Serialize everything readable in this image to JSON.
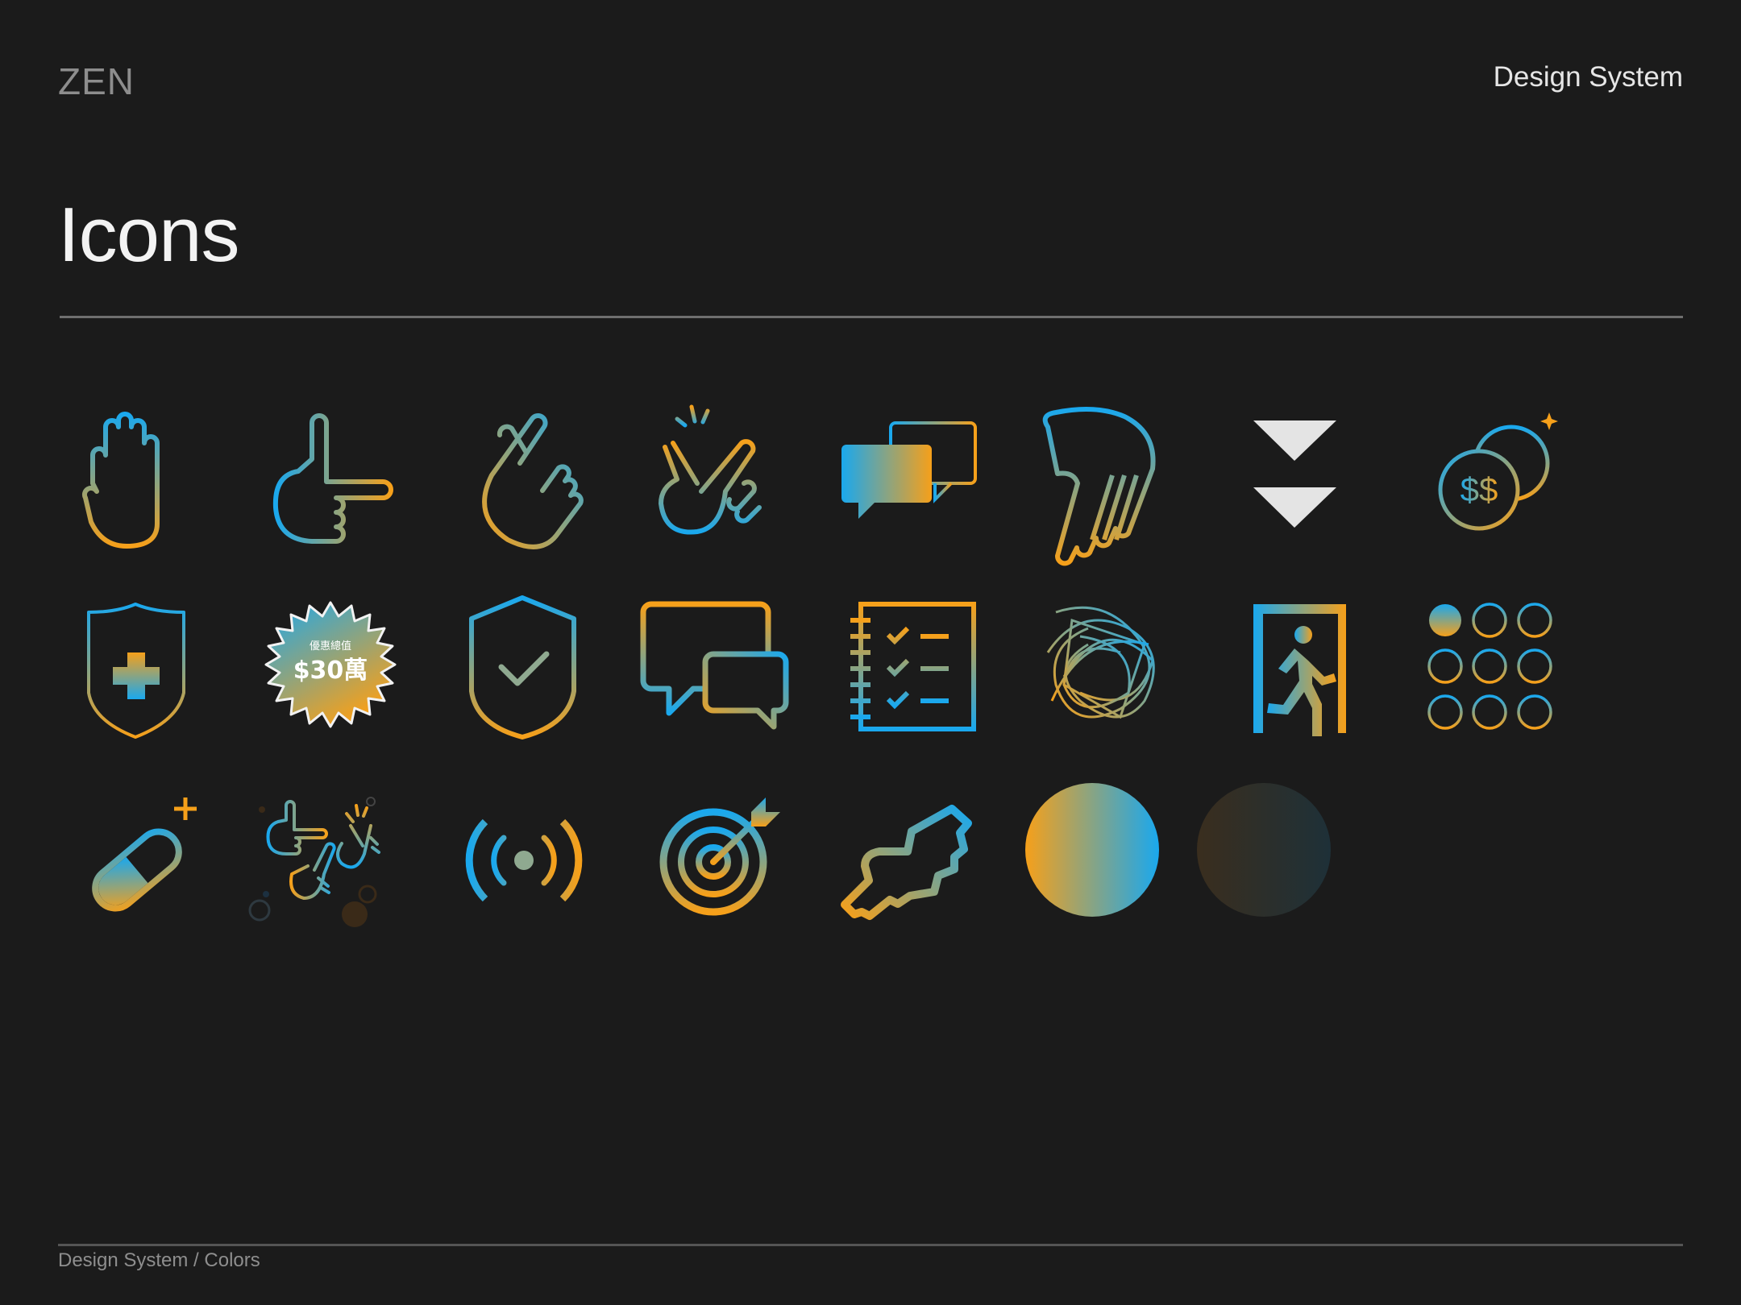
{
  "header": {
    "brand": "ZEN",
    "section": "Design System"
  },
  "page": {
    "title": "Icons"
  },
  "footer": {
    "breadcrumb": "Design System / Colors"
  },
  "colors": {
    "background": "#1b1b1b",
    "accent_blue": "#1aa8ee",
    "accent_orange": "#f6a01a",
    "arrow_white": "#e4e4e4"
  },
  "badge": {
    "small_text": "優惠總值",
    "amount": "$30萬"
  },
  "coin": {
    "label": "$$"
  },
  "icons": [
    "raised-hand-icon",
    "pointing-hand-icon",
    "crossed-fingers-icon",
    "finger-snap-icon",
    "chat-bubbles-icon",
    "helping-hand-icon",
    "double-down-arrow-icon",
    "coins-icon",
    "medical-shield-icon",
    "discount-badge-icon",
    "check-shield-icon",
    "conversation-icon",
    "checklist-icon",
    "tangled-lines-icon",
    "exit-door-icon",
    "dot-grid-icon",
    "pill-icon",
    "hand-gestures-cluster-icon",
    "broadcast-icon",
    "target-icon",
    "handshake-icon",
    "gradient-circle-icon",
    "dark-gradient-circle-icon"
  ]
}
